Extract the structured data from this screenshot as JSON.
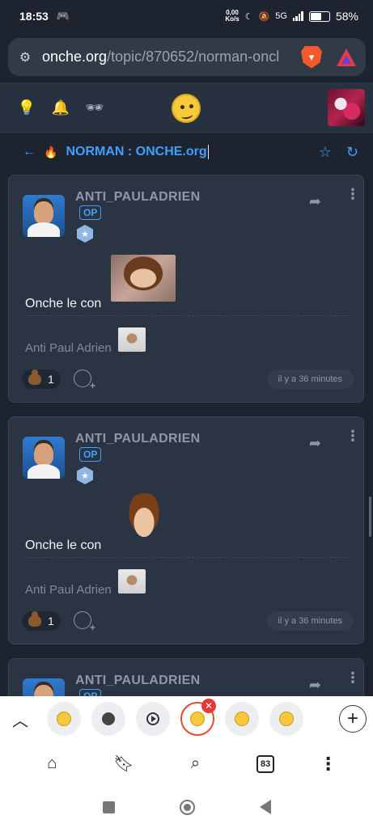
{
  "status": {
    "time": "18:53",
    "speed_value": "0,00",
    "speed_unit": "Ko/s",
    "network": "5G",
    "battery": "58%"
  },
  "browser": {
    "url_host": "onche.org",
    "url_path": "/topic/870652/norman-oncl",
    "tab_count": "83"
  },
  "topic": {
    "title": "NORMAN : ONCHE.org"
  },
  "posts": [
    {
      "author": "ANTI_PAULADRIEN",
      "op_label": "OP",
      "content": "Onche le con",
      "signature": "Anti Paul Adrien",
      "reaction_count": "1",
      "time": "il y a 36 minutes"
    },
    {
      "author": "ANTI_PAULADRIEN",
      "op_label": "OP",
      "content": "Onche le con",
      "signature": "Anti Paul Adrien",
      "reaction_count": "1",
      "time": "il y a 36 minutes"
    },
    {
      "author": "ANTI_PAULADRIEN",
      "op_label": "OP"
    }
  ],
  "colors": {
    "accent": "#3fa0ff",
    "background": "#1d2430",
    "card": "#2b3442"
  }
}
